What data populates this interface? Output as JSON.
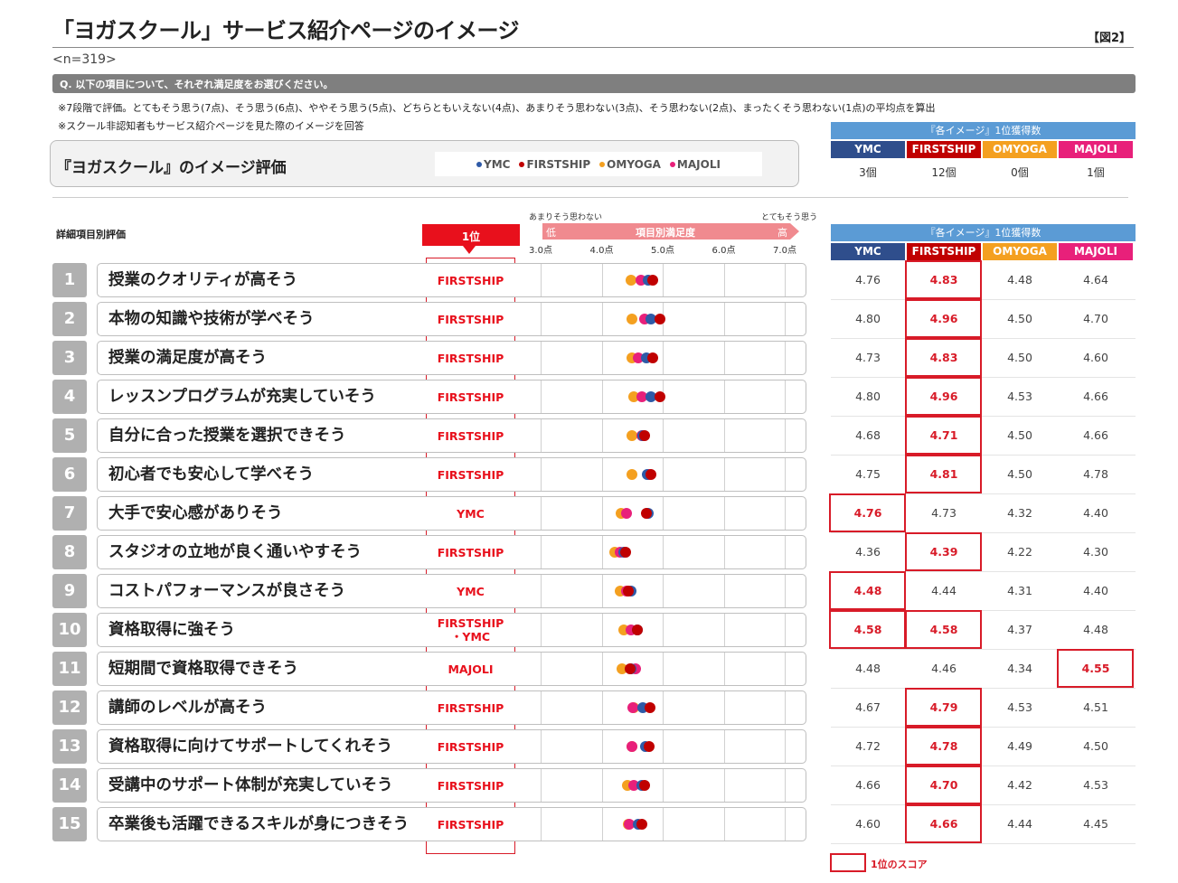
{
  "header": {
    "title": "「ヨガスクール」サービス紹介ページのイメージ",
    "figure_label": "【図2】",
    "sample_size": "<n=319>",
    "question": "Q. 以下の項目について、それぞれ満足度をお選びください。",
    "note1": "※7段階で評価。とてもそう思う(7点)、そう思う(6点)、ややそう思う(5点)、どちらともいえない(4点)、あまりそう思わない(3点)、そう思わない(2点)、まったくそう思わない(1点)の平均点を算出",
    "note2": "※スクール非認知者もサービス紹介ページを見た際のイメージを回答"
  },
  "panel": {
    "title": "『ヨガスクール』のイメージ評価",
    "legend": [
      "YMC",
      "FIRSTSHIP",
      "OMYOGA",
      "MAJOLI"
    ]
  },
  "section": {
    "sub_label": "詳細項目別評価",
    "rank_header": "1位",
    "scale_low_label": "あまりそう思わない",
    "scale_high_label": "とてもそう思う",
    "scale_low": "低",
    "scale_mid": "項目別満足度",
    "scale_high": "高",
    "ticks": [
      "3.0点",
      "4.0点",
      "5.0点",
      "6.0点",
      "7.0点"
    ]
  },
  "colors": {
    "YMC": "#2e5aa7",
    "FIRSTSHIP": "#c00000",
    "OMYOGA": "#f4a020",
    "MAJOLI": "#e8207a"
  },
  "summary_table": {
    "header": "『各イメージ』1位獲得数",
    "brands": [
      "YMC",
      "FIRSTSHIP",
      "OMYOGA",
      "MAJOLI"
    ],
    "brand_colors": [
      "#2f4e8c",
      "#c00000",
      "#f4a020",
      "#e8207a"
    ],
    "counts": [
      "3個",
      "12個",
      "0個",
      "1個"
    ]
  },
  "detail_table": {
    "header": "『各イメージ』1位獲得数",
    "brands": [
      "YMC",
      "FIRSTSHIP",
      "OMYOGA",
      "MAJOLI"
    ]
  },
  "legend_note": "1位のスコア",
  "chart_data": {
    "type": "scatter",
    "title": "『ヨガスクール』のイメージ評価",
    "xlabel": "項目別満足度",
    "xlim": [
      3.0,
      7.0
    ],
    "series_names": [
      "YMC",
      "FIRSTSHIP",
      "OMYOGA",
      "MAJOLI"
    ],
    "rows": [
      {
        "no": "1",
        "label": "授業のクオリティが高そう",
        "top": "FIRSTSHIP",
        "values": [
          4.76,
          4.83,
          4.48,
          4.64
        ],
        "winners": [
          1
        ]
      },
      {
        "no": "2",
        "label": "本物の知識や技術が学べそう",
        "top": "FIRSTSHIP",
        "values": [
          4.8,
          4.96,
          4.5,
          4.7
        ],
        "winners": [
          1
        ]
      },
      {
        "no": "3",
        "label": "授業の満足度が高そう",
        "top": "FIRSTSHIP",
        "values": [
          4.73,
          4.83,
          4.5,
          4.6
        ],
        "winners": [
          1
        ]
      },
      {
        "no": "4",
        "label": "レッスンプログラムが充実していそう",
        "top": "FIRSTSHIP",
        "values": [
          4.8,
          4.96,
          4.53,
          4.66
        ],
        "winners": [
          1
        ]
      },
      {
        "no": "5",
        "label": "自分に合った授業を選択できそう",
        "top": "FIRSTSHIP",
        "values": [
          4.68,
          4.71,
          4.5,
          4.66
        ],
        "winners": [
          1
        ]
      },
      {
        "no": "6",
        "label": "初心者でも安心して学べそう",
        "top": "FIRSTSHIP",
        "values": [
          4.75,
          4.81,
          4.5,
          4.78
        ],
        "winners": [
          1
        ]
      },
      {
        "no": "7",
        "label": "大手で安心感がありそう",
        "top": "YMC",
        "values": [
          4.76,
          4.73,
          4.32,
          4.4
        ],
        "winners": [
          0
        ]
      },
      {
        "no": "8",
        "label": "スタジオの立地が良く通いやすそう",
        "top": "FIRSTSHIP",
        "values": [
          4.36,
          4.39,
          4.22,
          4.3
        ],
        "winners": [
          1
        ]
      },
      {
        "no": "9",
        "label": "コストパフォーマンスが良さそう",
        "top": "YMC",
        "values": [
          4.48,
          4.44,
          4.31,
          4.4
        ],
        "winners": [
          0
        ]
      },
      {
        "no": "10",
        "label": "資格取得に強そう",
        "top": "FIRSTSHIP\n・YMC",
        "values": [
          4.58,
          4.58,
          4.37,
          4.48
        ],
        "winners": [
          0,
          1
        ]
      },
      {
        "no": "11",
        "label": "短期間で資格取得できそう",
        "top": "MAJOLI",
        "values": [
          4.48,
          4.46,
          4.34,
          4.55
        ],
        "winners": [
          3
        ]
      },
      {
        "no": "12",
        "label": "講師のレベルが高そう",
        "top": "FIRSTSHIP",
        "values": [
          4.67,
          4.79,
          4.53,
          4.51
        ],
        "winners": [
          1
        ]
      },
      {
        "no": "13",
        "label": "資格取得に向けてサポートしてくれそう",
        "top": "FIRSTSHIP",
        "values": [
          4.72,
          4.78,
          4.49,
          4.5
        ],
        "winners": [
          1
        ]
      },
      {
        "no": "14",
        "label": "受講中のサポート体制が充実していそう",
        "top": "FIRSTSHIP",
        "values": [
          4.66,
          4.7,
          4.42,
          4.53
        ],
        "winners": [
          1
        ]
      },
      {
        "no": "15",
        "label": "卒業後も活躍できるスキルが身につきそう",
        "top": "FIRSTSHIP",
        "values": [
          4.6,
          4.66,
          4.44,
          4.45
        ],
        "winners": [
          1
        ]
      }
    ]
  }
}
